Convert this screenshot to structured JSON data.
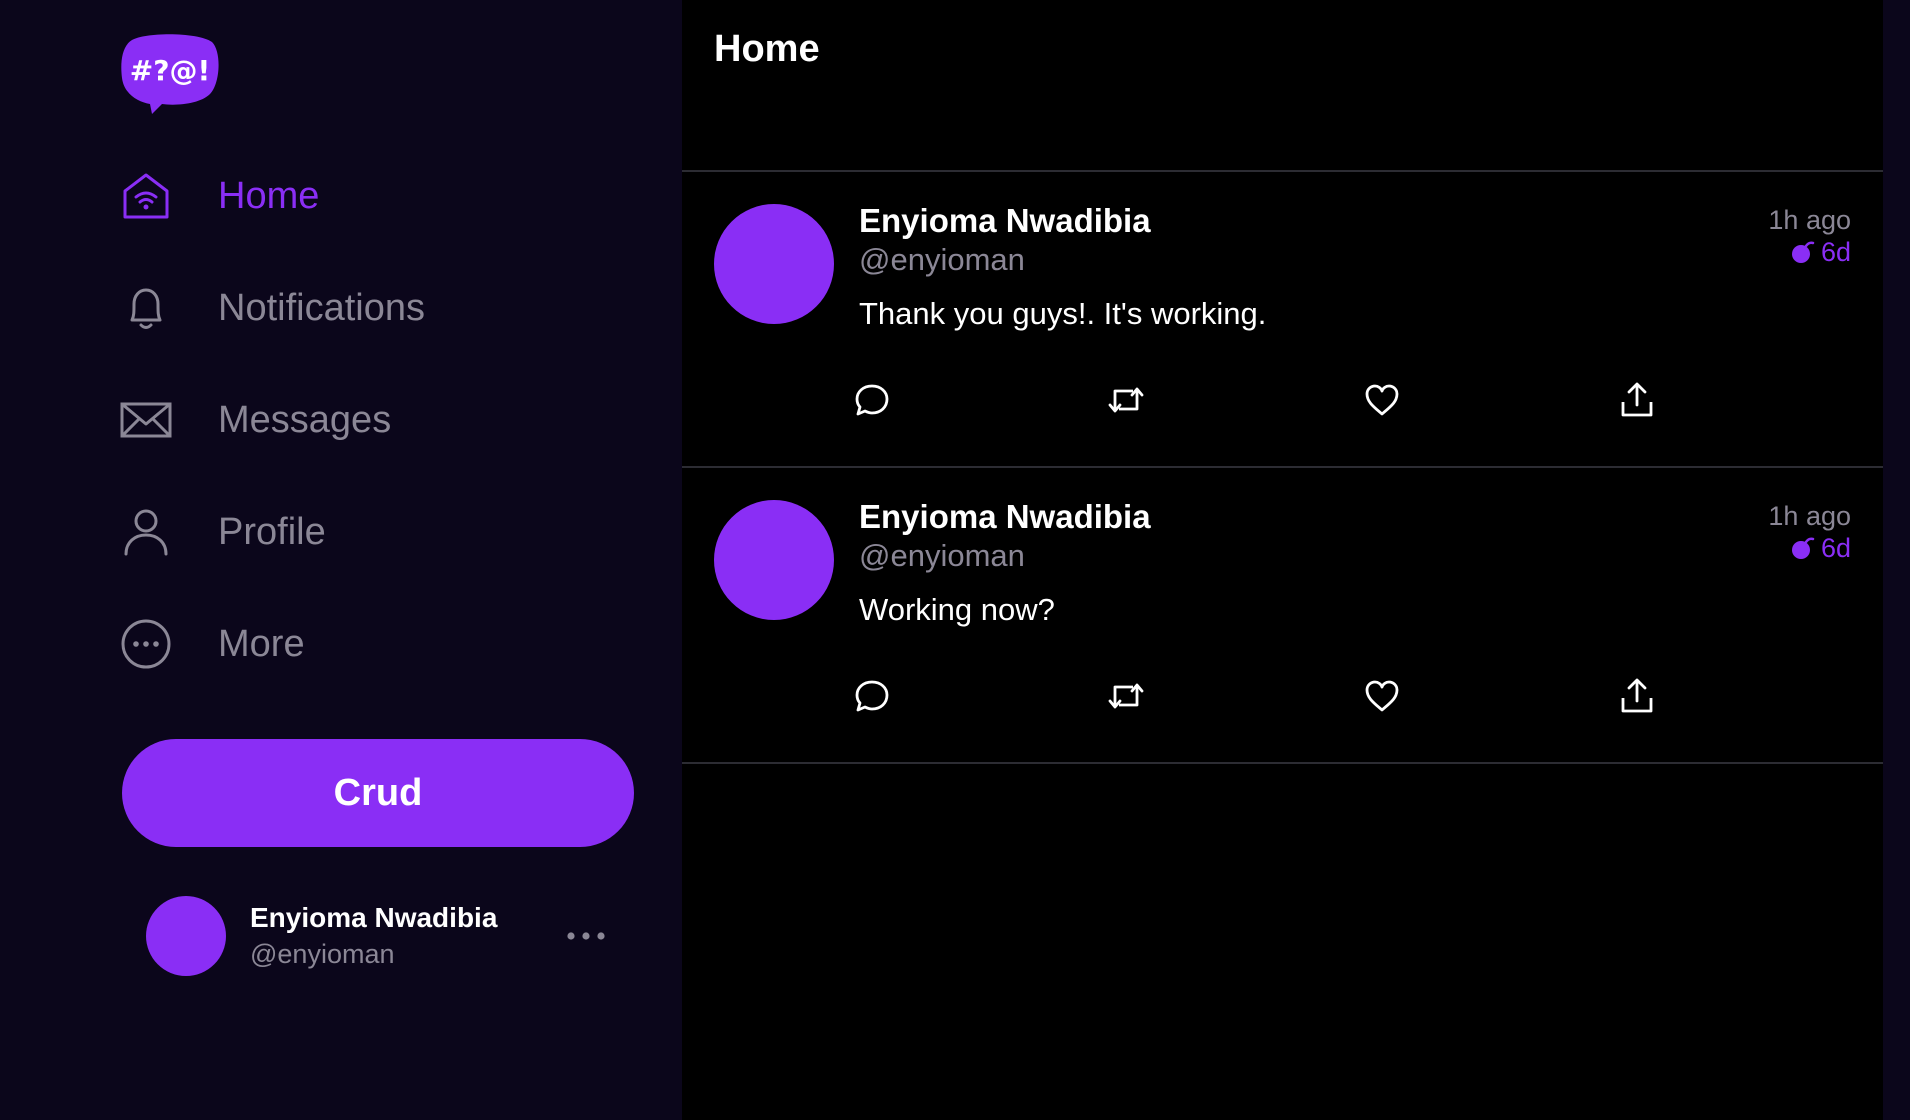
{
  "colors": {
    "accent": "#8a2ef5",
    "sidebar_bg": "#0b061b",
    "feed_bg": "#000000",
    "muted_text": "#8b8796",
    "divider": "#2c2c33"
  },
  "brand": {
    "logo_text": "#?@!",
    "logo_icon": "speech-bubble-logo"
  },
  "sidebar": {
    "nav": [
      {
        "label": "Home",
        "icon": "home-icon",
        "active": true
      },
      {
        "label": "Notifications",
        "icon": "bell-icon",
        "active": false
      },
      {
        "label": "Messages",
        "icon": "mail-icon",
        "active": false
      },
      {
        "label": "Profile",
        "icon": "person-icon",
        "active": false
      },
      {
        "label": "More",
        "icon": "more-circle-icon",
        "active": false
      }
    ],
    "cta_label": "Crud",
    "account": {
      "name": "Enyioma Nwadibia",
      "handle": "@enyioman"
    }
  },
  "main": {
    "title": "Home",
    "posts": [
      {
        "author": "Enyioma Nwadibia",
        "handle": "@enyioman",
        "content": "Thank you guys!. It's working.",
        "time": "1h ago",
        "ttl": "6d"
      },
      {
        "author": "Enyioma Nwadibia",
        "handle": "@enyioman",
        "content": "Working now?",
        "time": "1h ago",
        "ttl": "6d"
      }
    ],
    "action_icons": [
      "reply-icon",
      "repost-icon",
      "like-icon",
      "share-icon"
    ]
  }
}
